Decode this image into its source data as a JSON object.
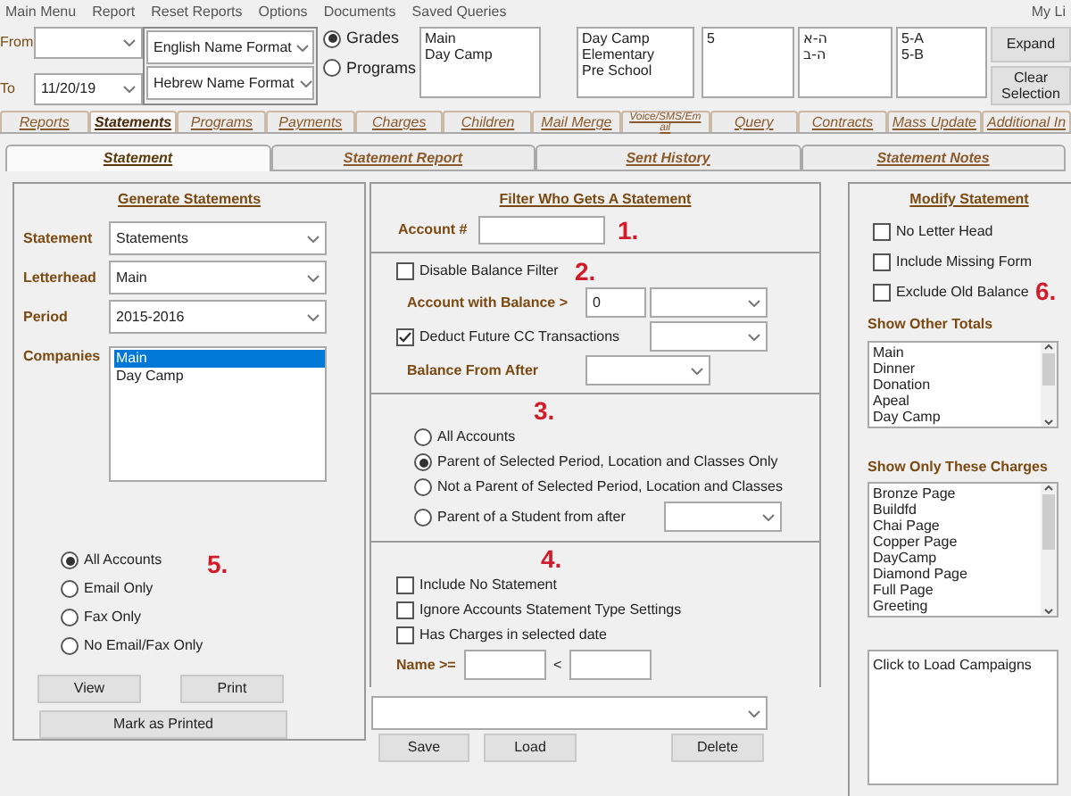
{
  "menu_bar": [
    "Main Menu",
    "Report",
    "Reset Reports",
    "Options",
    "Documents",
    "Saved Queries"
  ],
  "menu_right": "My Li",
  "date_filters": [
    {
      "label": "From"
    },
    {
      "label": "To",
      "value": "11/20/19"
    }
  ],
  "name_formats": [
    "English Name Format",
    "Hebrew Name Format"
  ],
  "group_by": [
    {
      "label": "Grades",
      "selected": true
    },
    {
      "label": "Programs",
      "selected": false
    }
  ],
  "selection_lists": [
    [
      "Main",
      "Day Camp"
    ],
    [
      "Day Camp",
      "Elementary",
      "Pre School"
    ],
    [
      "5"
    ],
    [
      "ה-א",
      "ה-ב"
    ],
    [
      "5-A",
      "5-B"
    ]
  ],
  "side_buttons": [
    "Expand",
    "Clear Selection"
  ],
  "main_tabs": [
    {
      "label": "Reports",
      "selected": false
    },
    {
      "label": "Statements",
      "selected": true
    },
    {
      "label": "Programs",
      "selected": false
    },
    {
      "label": "Payments",
      "selected": false
    },
    {
      "label": "Charges",
      "selected": false
    },
    {
      "label": "Children",
      "selected": false
    },
    {
      "label": "Mail Merge",
      "selected": false
    },
    {
      "label": "Voice/SMS/Em ail",
      "selected": false
    },
    {
      "label": "Query",
      "selected": false
    },
    {
      "label": "Contracts",
      "selected": false
    },
    {
      "label": "Mass Update",
      "selected": false
    },
    {
      "label": "Additional In",
      "selected": false
    }
  ],
  "sub_tabs": [
    {
      "label": "Statement",
      "selected": true
    },
    {
      "label": "Statement Report",
      "selected": false
    },
    {
      "label": "Sent History",
      "selected": false
    },
    {
      "label": "Statement Notes",
      "selected": false
    }
  ],
  "generate": {
    "title": "Generate Statements",
    "fields": [
      {
        "label": "Statement",
        "value": "Statements"
      },
      {
        "label": "Letterhead",
        "value": "Main"
      },
      {
        "label": "Period",
        "value": "2015-2016"
      }
    ],
    "companies": {
      "label": "Companies",
      "items": [
        {
          "text": "Main",
          "selected": true
        },
        {
          "text": "Day Camp",
          "selected": false
        }
      ]
    },
    "marker": "5.",
    "delivery": [
      {
        "label": "All Accounts",
        "selected": true
      },
      {
        "label": "Email Only",
        "selected": false
      },
      {
        "label": "Fax Only",
        "selected": false
      },
      {
        "label": "No Email/Fax Only",
        "selected": false
      }
    ],
    "buttons": [
      "View",
      "Print"
    ],
    "wide_button": "Mark as Printed"
  },
  "filter": {
    "title": "Filter Who Gets A Statement",
    "account": {
      "label": "Account #",
      "marker": "1."
    },
    "balance": {
      "marker": "2.",
      "disable": {
        "label": "Disable Balance Filter",
        "checked": false
      },
      "min": {
        "label": "Account with Balance >",
        "value": "0"
      },
      "deduct": {
        "label": "Deduct Future CC Transactions",
        "checked": true
      },
      "from_after": {
        "label": "Balance From After"
      }
    },
    "accounts": {
      "marker": "3.",
      "options": [
        {
          "kind": "radio",
          "label": "All Accounts",
          "selected": false
        },
        {
          "kind": "radio",
          "label": "Parent of Selected Period, Location and Classes  Only",
          "selected": true
        },
        {
          "kind": "radio",
          "label": "Not a Parent of Selected Period, Location and Classes",
          "selected": false
        },
        {
          "kind": "radio_dropdown",
          "label": "Parent of a Student from after",
          "selected": false
        }
      ]
    },
    "extra": {
      "marker": "4.",
      "checks": [
        {
          "label": "Include No Statement",
          "checked": false
        },
        {
          "label": "Ignore Accounts Statement Type Settings",
          "checked": false
        },
        {
          "label": "Has Charges in selected date",
          "checked": false
        }
      ],
      "name_range": {
        "label": "Name >=",
        "separator": "<"
      }
    },
    "query_buttons": [
      "Save",
      "Load",
      "Delete"
    ]
  },
  "modify": {
    "title": "Modify Statement",
    "marker": "6.",
    "checks": [
      {
        "label": "No Letter Head",
        "checked": false
      },
      {
        "label": "Include Missing Form",
        "checked": false
      },
      {
        "label": "Exclude Old Balance",
        "checked": false
      }
    ],
    "other_totals": {
      "title": "Show Other Totals",
      "items": [
        "Main",
        "Dinner",
        "Donation",
        "Apeal",
        "Day Camp"
      ]
    },
    "charges": {
      "title": "Show Only These Charges",
      "items": [
        "Bronze Page",
        "Buildfd",
        "Chai Page",
        "Copper Page",
        "DayCamp",
        "Diamond Page",
        "Full Page",
        "Greeting"
      ]
    },
    "campaigns": "Click to Load Campaigns"
  }
}
